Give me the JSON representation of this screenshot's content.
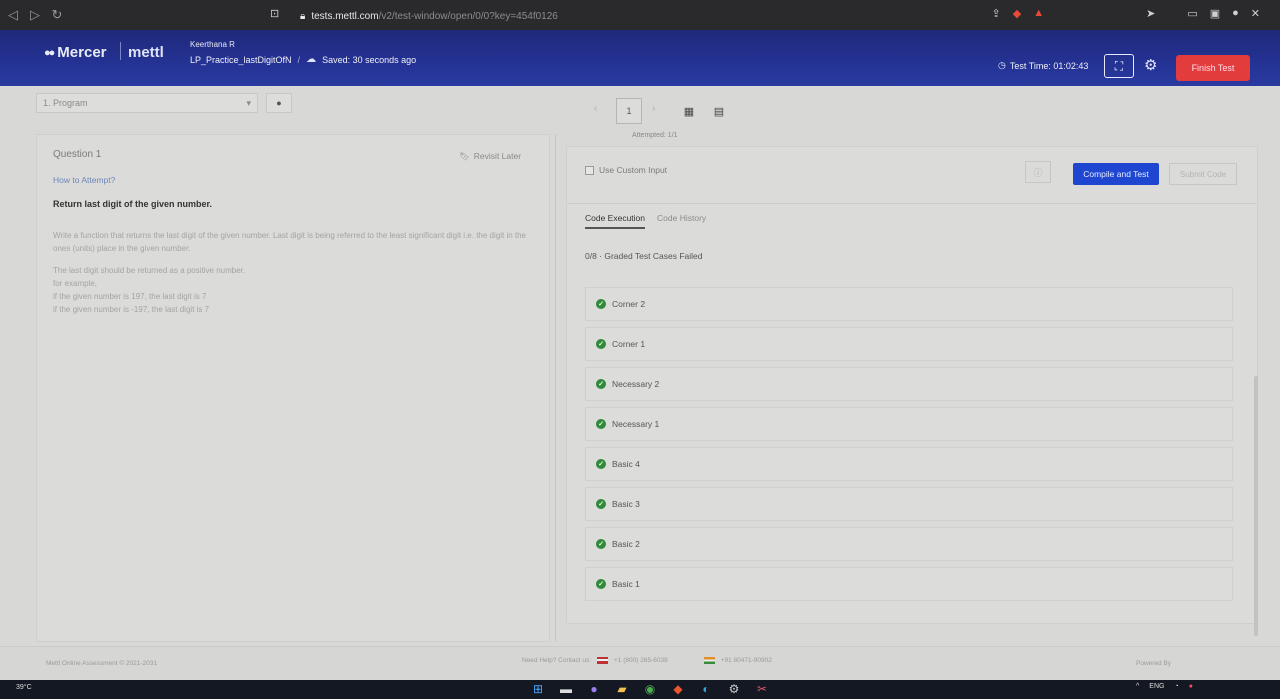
{
  "browser": {
    "url_domain": "tests.mettl.com",
    "url_path": "/v2/test-window/open/0/0?key=454f0126"
  },
  "header": {
    "logo": "Mercer",
    "logo2": "mettl",
    "user_name": "Keerthana R",
    "test_name": "LP_Practice_lastDigitOfN",
    "separator": "/",
    "saved_status": "Saved: 30 seconds ago",
    "test_time": "Test Time: 01:02:43",
    "finish_label": "Finish Test"
  },
  "toolbar": {
    "program_select": "1. Program",
    "page_number": "1",
    "attempted": "Attempted: 1/1"
  },
  "question": {
    "title": "Question 1",
    "revisit_label": "Revisit Later",
    "how_to": "How to Attempt?",
    "heading": "Return last digit of the given number.",
    "para1": "Write a function that returns the last digit of the given number. Last digit is being referred to the least significant digit i.e. the digit in the ones (units) place in the given number.",
    "para2_line1": "The last digit should be returned as a positive number.",
    "para2_line2": "for example,",
    "para2_line3": "if the given number is 197, the last digit is 7",
    "para2_line4": "if the given number is -197, the last digit is 7"
  },
  "editor": {
    "custom_input_label": "Use Custom Input",
    "compile_label": "Compile and Test",
    "submit_label": "Submit Code",
    "tab_execution": "Code Execution",
    "tab_history": "Code History",
    "summary": "0/8 · Graded Test Cases Failed",
    "cases": [
      "Corner 2",
      "Corner 1",
      "Necessary 2",
      "Necessary 1",
      "Basic 4",
      "Basic 3",
      "Basic 2",
      "Basic 1"
    ]
  },
  "footer": {
    "copyright": "Mettl Online Assessment © 2021-2031",
    "help_label": "Need Help? Contact us:",
    "phone_us": "+1 (800) 265-6038",
    "phone_in": "+91 80471-90902",
    "powered": "Powered By"
  },
  "taskbar": {
    "temp": "39°C",
    "lang": "ENG"
  },
  "colors": {
    "header_bg": "#243294",
    "compile_bg": "#1f46d0",
    "finish_bg": "#e33c3c",
    "pass_green": "#2f8a3a"
  }
}
